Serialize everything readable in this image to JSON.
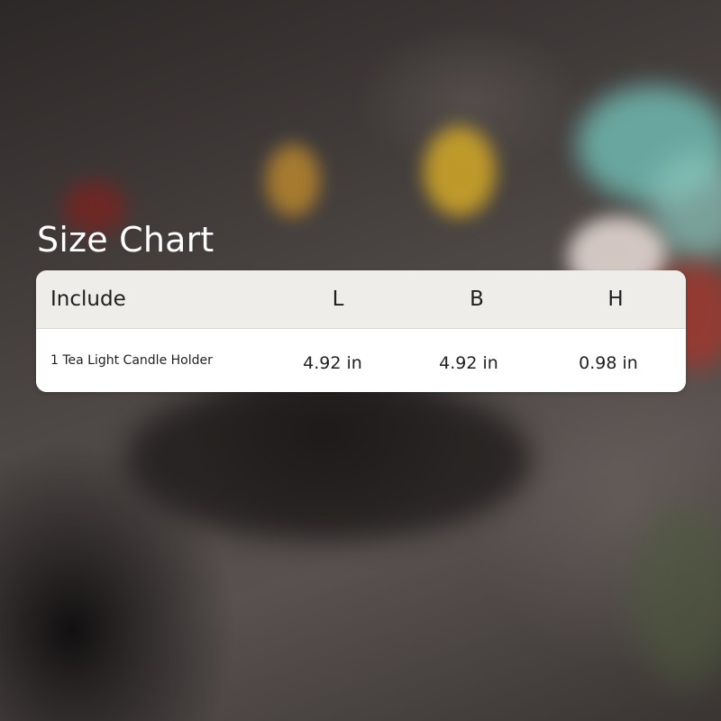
{
  "title": "Size Chart",
  "table": {
    "headers": [
      "Include",
      "L",
      "B",
      "H"
    ],
    "rows": [
      [
        "1 Tea Light Candle Holder",
        "4.92 in",
        "4.92 in",
        "0.98 in"
      ]
    ]
  },
  "colors": {
    "header_background": "#efede9",
    "body_background": "#ffffff",
    "title_text": "#ffffff",
    "table_text": "#1f1f1f"
  }
}
